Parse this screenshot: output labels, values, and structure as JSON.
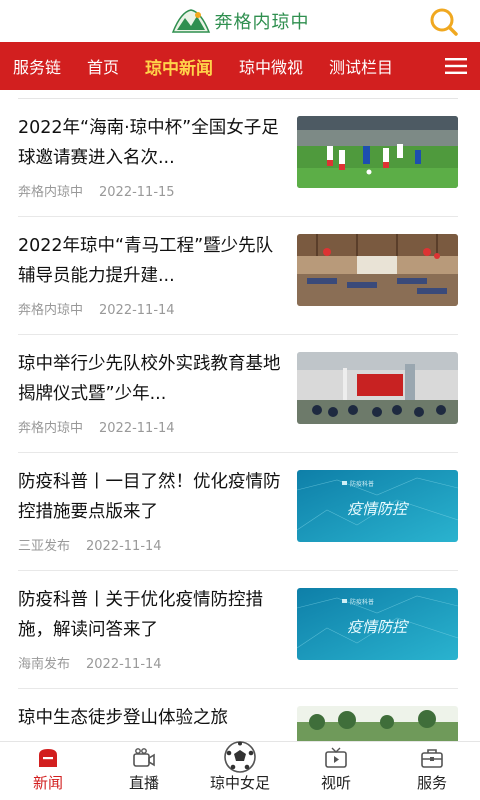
{
  "header": {
    "logo_text": "奔格内琼中",
    "logo_icon": "mountain-logo",
    "search_icon": "search-icon"
  },
  "nav": {
    "items": [
      {
        "label": "服务链",
        "active": false
      },
      {
        "label": "首页",
        "active": false
      },
      {
        "label": "琼中新闻",
        "active": true
      },
      {
        "label": "琼中微视",
        "active": false
      },
      {
        "label": "测试栏目",
        "active": false
      }
    ],
    "menu_icon": "hamburger-menu-icon",
    "active_color": "#ffd24a",
    "bar_color": "#d21f1f"
  },
  "articles": [
    {
      "title": "2022年“海南·琼中杯”全国女子足球邀请赛进入名次...",
      "source": "奔格内琼中",
      "date": "2022-11-15",
      "thumb": "soccer-photo"
    },
    {
      "title": "2022年琼中“青马工程”暨少先队辅导员能力提升建...",
      "source": "奔格内琼中",
      "date": "2022-11-14",
      "thumb": "hall-photo"
    },
    {
      "title": "琼中举行少先队校外实践教育基地揭牌仪式暨”少年...",
      "source": "奔格内琼中",
      "date": "2022-11-14",
      "thumb": "firestation-photo"
    },
    {
      "title": "防疫科普丨一目了然！优化疫情防控措施要点版来了",
      "source": "三亚发布",
      "date": "2022-11-14",
      "thumb": "epidemic-banner",
      "banner_text": "疫情防控"
    },
    {
      "title": "防疫科普丨关于优化疫情防控措施，解读问答来了",
      "source": "海南发布",
      "date": "2022-11-14",
      "thumb": "epidemic-banner",
      "banner_text": "疫情防控"
    },
    {
      "title": "琼中生态徒步登山体验之旅",
      "source": "",
      "date": "",
      "thumb": "landscape-photo"
    }
  ],
  "tabbar": {
    "tabs": [
      {
        "label": "新闻",
        "icon": "news-icon",
        "active": true
      },
      {
        "label": "直播",
        "icon": "camera-icon",
        "active": false
      },
      {
        "label": "琼中女足",
        "icon": "soccer-ball-icon",
        "active": false
      },
      {
        "label": "视听",
        "icon": "tv-icon",
        "active": false
      },
      {
        "label": "服务",
        "icon": "briefcase-icon",
        "active": false
      }
    ]
  }
}
